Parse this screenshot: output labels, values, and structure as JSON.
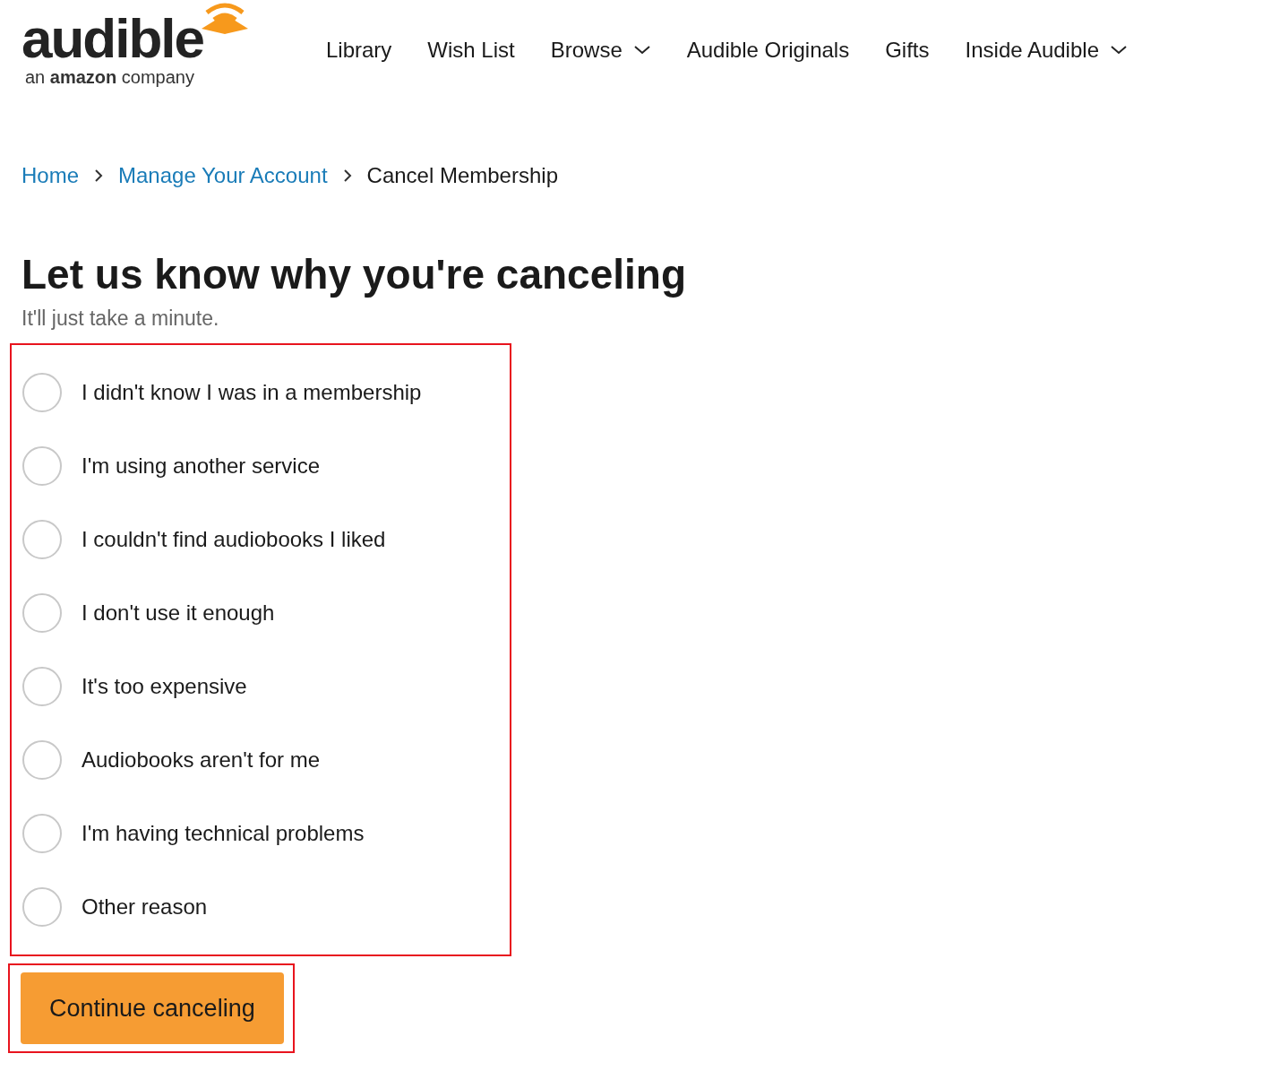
{
  "logo": {
    "wordmark": "audible",
    "tagline": "an **amazon** company"
  },
  "nav": [
    {
      "label": "Library",
      "dropdown": false
    },
    {
      "label": "Wish List",
      "dropdown": false
    },
    {
      "label": "Browse",
      "dropdown": true
    },
    {
      "label": "Audible Originals",
      "dropdown": false
    },
    {
      "label": "Gifts",
      "dropdown": false
    },
    {
      "label": "Inside Audible",
      "dropdown": true
    }
  ],
  "breadcrumbs": [
    {
      "label": "Home",
      "link": true
    },
    {
      "label": "Manage Your Account",
      "link": true
    },
    {
      "label": "Cancel Membership",
      "link": false
    }
  ],
  "heading": "Let us know why you're canceling",
  "subtitle": "It'll just take a minute.",
  "reasons": {
    "highlighted": true,
    "options": [
      {
        "label": "I didn't know I was in a membership",
        "selected": false
      },
      {
        "label": "I'm using another service",
        "selected": false
      },
      {
        "label": "I couldn't find audiobooks I liked",
        "selected": false
      },
      {
        "label": "I don't use it enough",
        "selected": false
      },
      {
        "label": "It's too expensive",
        "selected": false
      },
      {
        "label": "Audiobooks aren't for me",
        "selected": false
      },
      {
        "label": "I'm having technical problems",
        "selected": false
      },
      {
        "label": "Other reason",
        "selected": false
      }
    ]
  },
  "continue_button": {
    "label": "Continue canceling",
    "highlighted": true
  }
}
